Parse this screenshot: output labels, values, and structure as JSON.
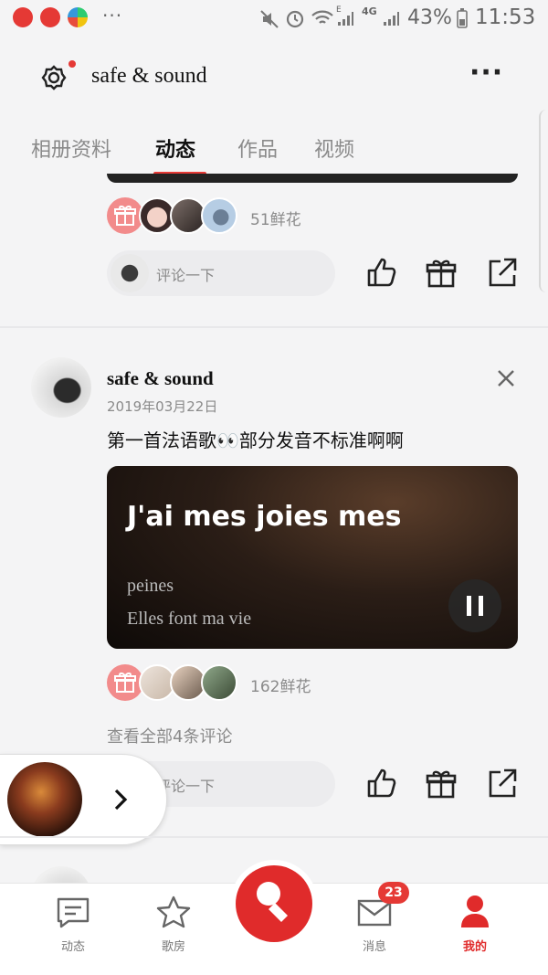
{
  "status_bar": {
    "dots": "···",
    "battery": "43%",
    "time": "11:53",
    "network": "4G",
    "wifi_badge": "E"
  },
  "header": {
    "title": "safe & sound",
    "more": "···"
  },
  "tabs": [
    {
      "label": "相册资料",
      "active": false
    },
    {
      "label": "动态",
      "active": true
    },
    {
      "label": "作品",
      "active": false
    },
    {
      "label": "视频",
      "active": false
    }
  ],
  "post1": {
    "flowers": "51鲜花",
    "comment_placeholder": "评论一下"
  },
  "post2": {
    "author": "safe & sound",
    "date": "2019年03月22日",
    "text": "第一首法语歌👀部分发音不标准啊啊",
    "lyric_main": "J'ai mes joies mes",
    "lyric_line2": "peines",
    "lyric_line3": "Elles font ma vie",
    "flowers": "162鲜花",
    "view_comments": "查看全部4条评论",
    "comment_placeholder": "评论一下"
  },
  "bottom_nav": {
    "items": [
      {
        "label": "动态"
      },
      {
        "label": "歌房"
      },
      {
        "label": ""
      },
      {
        "label": "消息"
      },
      {
        "label": "我的"
      }
    ],
    "message_badge": "23"
  },
  "colors": {
    "accent": "#e53935",
    "background": "#f4f4f5"
  }
}
